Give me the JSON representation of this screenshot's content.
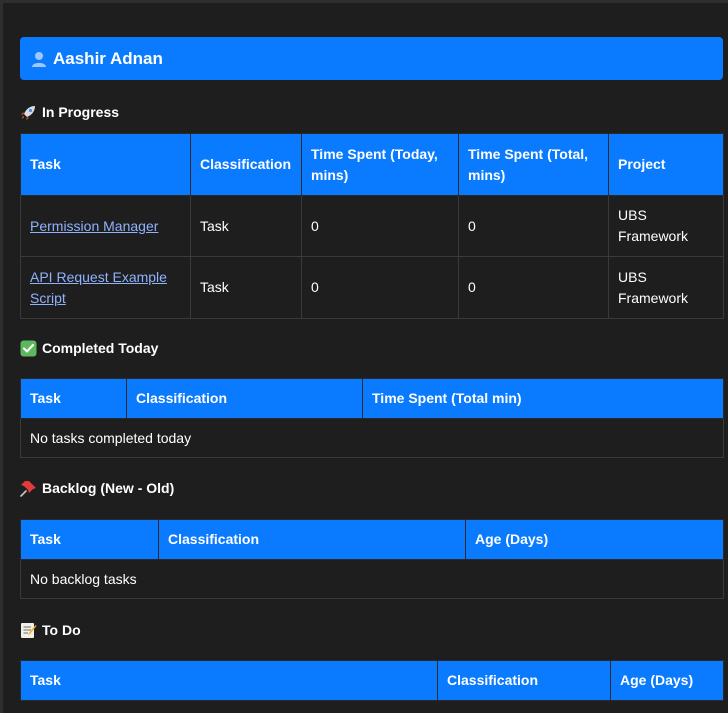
{
  "user": {
    "name": "Aashir Adnan",
    "icon": "user-silhouette-icon"
  },
  "in_progress": {
    "title": "In Progress",
    "icon": "rocket-icon",
    "headers": [
      "Task",
      "Classification",
      "Time Spent (Today, mins)",
      "Time Spent (Total, mins)",
      "Project"
    ],
    "rows": [
      {
        "task": "Permission Manager",
        "classification": "Task",
        "today": "0",
        "total": "0",
        "project": "UBS Framework"
      },
      {
        "task": "API Request Example Script",
        "classification": "Task",
        "today": "0",
        "total": "0",
        "project": "UBS Framework"
      }
    ]
  },
  "completed": {
    "title": "Completed Today",
    "icon": "check-mark-icon",
    "headers": [
      "Task",
      "Classification",
      "Time Spent (Total min)"
    ],
    "empty": "No tasks completed today"
  },
  "backlog": {
    "title": "Backlog (New - Old)",
    "icon": "pushpin-icon",
    "headers": [
      "Task",
      "Classification",
      "Age (Days)"
    ],
    "empty": "No backlog tasks"
  },
  "todo": {
    "title": "To Do",
    "icon": "memo-icon",
    "headers": [
      "Task",
      "Classification",
      "Age (Days)"
    ]
  },
  "colors": {
    "accent": "#0a7bff",
    "background": "#1e1e1e",
    "link": "#8fb2ff"
  }
}
